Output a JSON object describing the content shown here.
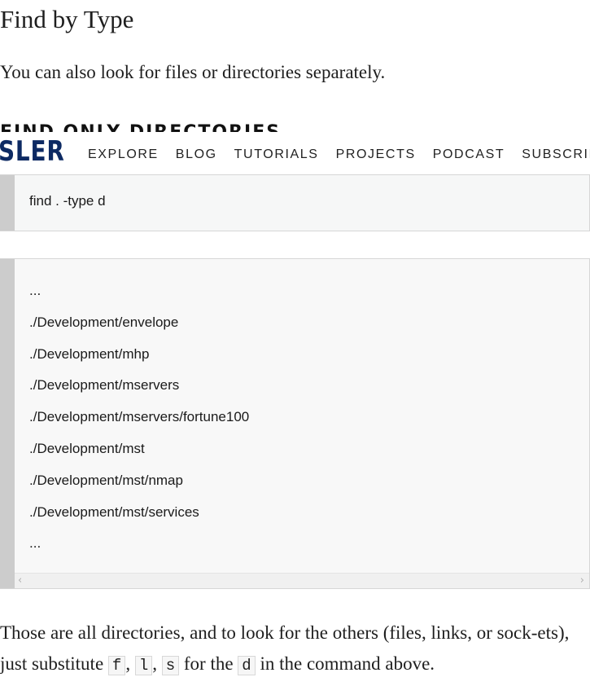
{
  "article": {
    "section_title": "Find by Type",
    "intro": "You can also look for files or directories separately.",
    "subsection_title": "Find only directories"
  },
  "nav": {
    "logo": "SLER",
    "links": [
      "EXPLORE",
      "BLOG",
      "TUTORIALS",
      "PROJECTS",
      "PODCAST",
      "SUBSCRIBE"
    ]
  },
  "command": "find . -type d",
  "output": [
    "...",
    "./Development/envelope",
    "./Development/mhp",
    "./Development/mservers",
    "./Development/mservers/fortune100",
    "./Development/mst",
    "./Development/mst/nmap",
    "./Development/mst/services",
    "..."
  ],
  "outro": {
    "part1": "Those are all directories, and to look for the others (files, links, or sock-ets), just substitute ",
    "code1": "f",
    "sep1": ", ",
    "code2": "l",
    "sep2": ", ",
    "code3": "s",
    "part2": " for the ",
    "code4": "d",
    "part3": " in the command above."
  },
  "icons": {
    "scroll_left": "chevron-left-icon",
    "scroll_right": "chevron-right-icon"
  }
}
